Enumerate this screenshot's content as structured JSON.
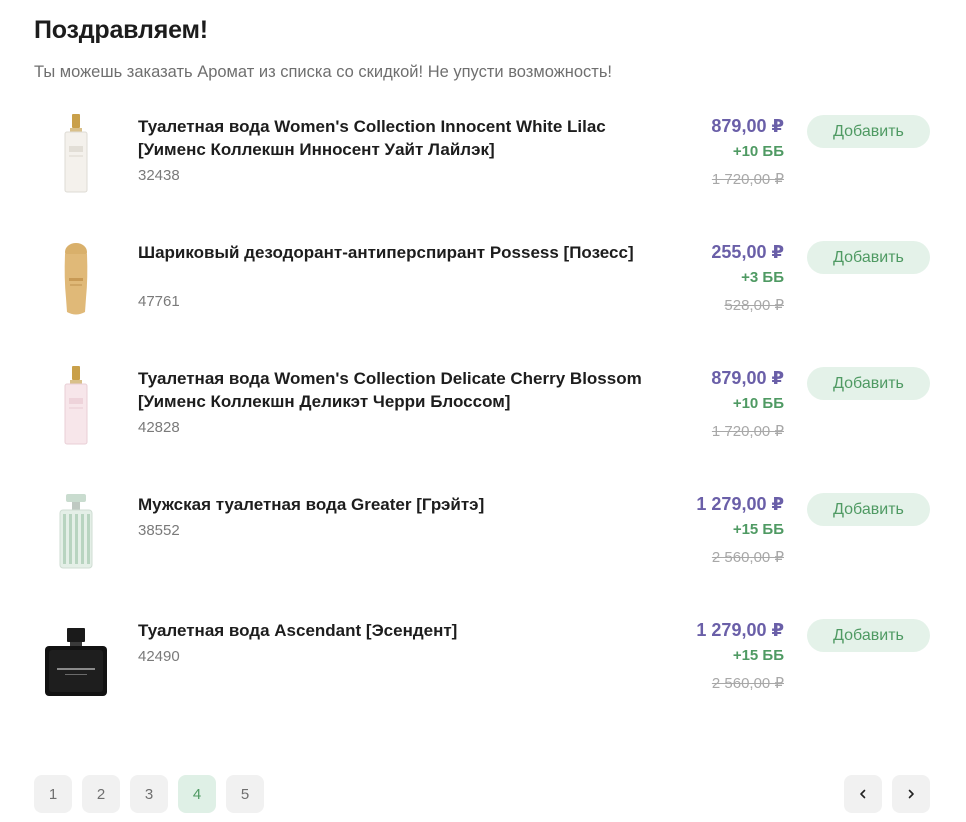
{
  "header": {
    "title": "Поздравляем!",
    "subtitle": "Ты можешь заказать Аромат из списка со скидкой! Не упусти возможность!"
  },
  "products": [
    {
      "name": "Туалетная вода Women's Collection Innocent White Lilac [Уименс Коллекшн Инносент Уайт Лайлэк]",
      "sku": "32438",
      "price": "879,00 ₽",
      "bonus": "+10 ББ",
      "old_price": "1 720,00 ₽",
      "image": "white-lilac-bottle-icon",
      "button": "Добавить"
    },
    {
      "name": "Шариковый дезодорант-антиперспирант Possess [Позесс]",
      "sku": "47761",
      "price": "255,00 ₽",
      "bonus": "+3 ББ",
      "old_price": "528,00 ₽",
      "image": "roll-on-deodorant-icon",
      "button": "Добавить"
    },
    {
      "name": "Туалетная вода Women's Collection Delicate Cherry Blossom [Уименс Коллекшн Деликэт Черри Блоссом]",
      "sku": "42828",
      "price": "879,00 ₽",
      "bonus": "+10 ББ",
      "old_price": "1 720,00 ₽",
      "image": "cherry-blossom-bottle-icon",
      "button": "Добавить"
    },
    {
      "name": "Мужская туалетная вода Greater [Грэйтэ]",
      "sku": "38552",
      "price": "1 279,00 ₽",
      "bonus": "+15 ББ",
      "old_price": "2 560,00 ₽",
      "image": "greater-bottle-icon",
      "button": "Добавить"
    },
    {
      "name": "Туалетная вода Ascendant [Эсендент]",
      "sku": "42490",
      "price": "1 279,00 ₽",
      "bonus": "+15 ББ",
      "old_price": "2 560,00 ₽",
      "image": "ascendant-bottle-icon",
      "button": "Добавить"
    }
  ],
  "pagination": {
    "pages": [
      "1",
      "2",
      "3",
      "4",
      "5"
    ],
    "active": "4",
    "prev": "‹",
    "next": "›"
  },
  "colors": {
    "price": "#6a5fa8",
    "bonus": "#4f9a63",
    "button_bg": "#e4f2e9",
    "active_page_bg": "#dff0e6"
  }
}
